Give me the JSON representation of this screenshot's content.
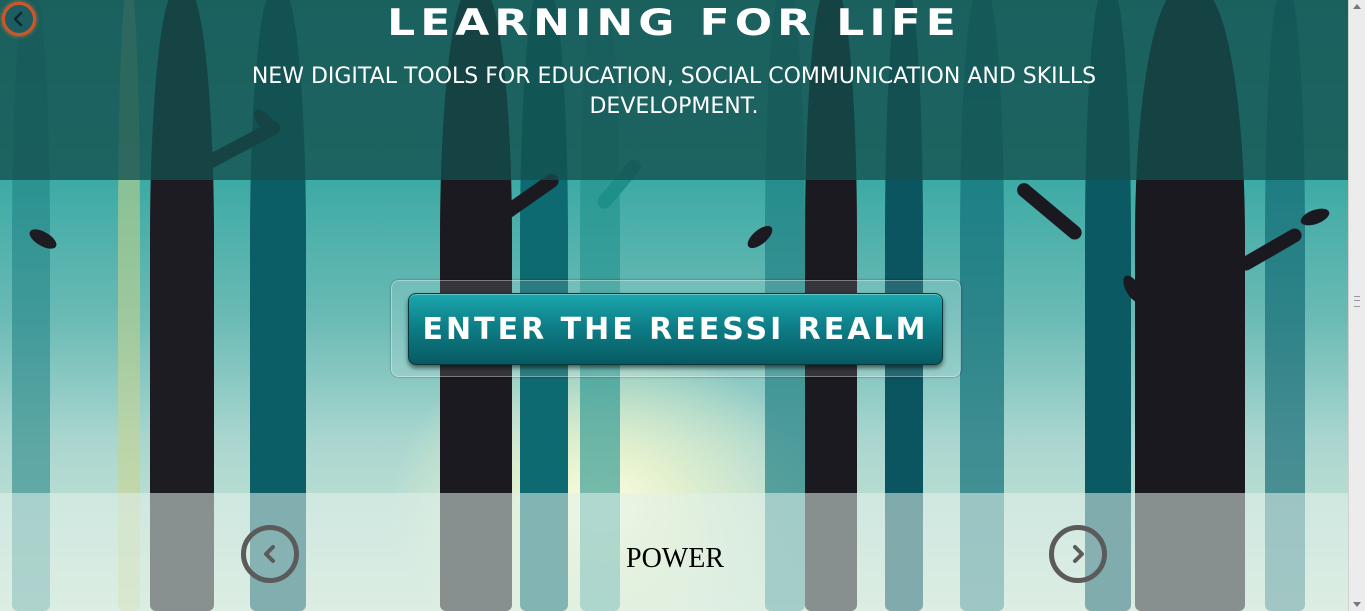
{
  "header": {
    "title": "LEARNING FOR LIFE",
    "subtitle": "NEW DIGITAL TOOLS FOR EDUCATION, SOCIAL COMMUNICATION AND SKILLS DEVELOPMENT."
  },
  "main": {
    "enter_label": "ENTER THE REESSI REALM"
  },
  "carousel": {
    "current_label": "POWER"
  },
  "icons": {
    "back": "chevron-left-circle-icon",
    "prev": "chevron-left-circle-icon",
    "next": "chevron-right-circle-icon"
  },
  "colors": {
    "header_band": "#14504E",
    "button_teal": "#0E7F88",
    "back_ring": "#D1542A",
    "arrow_gray": "#5B5B5B"
  }
}
